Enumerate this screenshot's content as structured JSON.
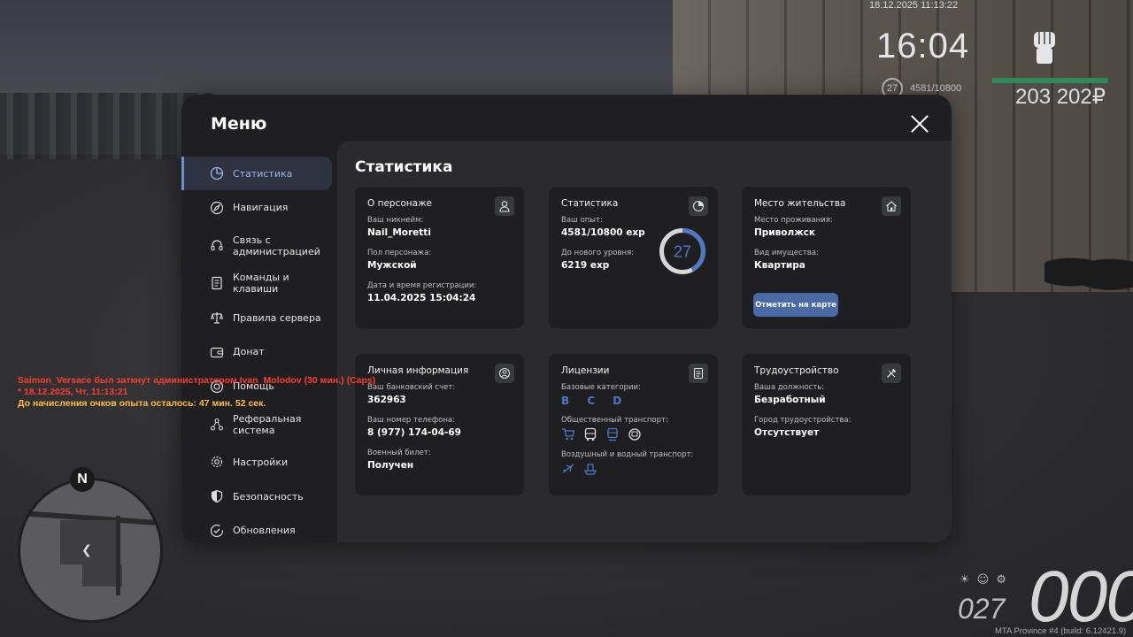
{
  "hud": {
    "datetime": "18.12.2025 11:13:22",
    "clock": "16:04",
    "level": "27",
    "exp": "4581/10800",
    "money": "203 202₽",
    "hp_fraction": 0.99
  },
  "chat": [
    {
      "text": "Saimon_Versace был заткнут администратором Ivan_Molodov (30 мин.) (Caps)",
      "color": "#ff3b2e"
    },
    {
      "text": "* 18.12.2025, Чт, 11:13:21",
      "color": "#ff3b2e"
    },
    {
      "text": "До начисления очков опыта осталось: 47 мин. 52 сек.",
      "color": "#ffbd3a"
    }
  ],
  "minimap": {
    "north_label": "N"
  },
  "speedometer": {
    "gear": "027",
    "speed": "000"
  },
  "build_info": "MTA Province #4 (build: 6.12421.9)",
  "menu": {
    "title": "Меню",
    "sidebar": [
      {
        "label": "Статистика",
        "icon": "pie-chart-icon",
        "active": true
      },
      {
        "label": "Навигация",
        "icon": "compass-icon",
        "active": false
      },
      {
        "label": "Связь с администрацией",
        "icon": "headset-icon",
        "active": false
      },
      {
        "label": "Команды и клавиши",
        "icon": "document-icon",
        "active": false
      },
      {
        "label": "Правила сервера",
        "icon": "scales-icon",
        "active": false
      },
      {
        "label": "Донат",
        "icon": "wallet-icon",
        "active": false
      },
      {
        "label": "Помощь",
        "icon": "help-icon",
        "active": false
      },
      {
        "label": "Реферальная система",
        "icon": "network-icon",
        "active": false
      },
      {
        "label": "Настройки",
        "icon": "gear-icon",
        "active": false
      },
      {
        "label": "Безопасность",
        "icon": "shield-icon",
        "active": false
      },
      {
        "label": "Обновления",
        "icon": "update-icon",
        "active": false
      }
    ],
    "content_title": "Статистика",
    "cards": {
      "character": {
        "title": "О персонаже",
        "nickname_label": "Ваш никнейм:",
        "nickname": "Nail_Moretti",
        "gender_label": "Пол персонажа:",
        "gender": "Мужской",
        "reg_label": "Дата и время регистрации:",
        "reg": "11.04.2025 15:04:24"
      },
      "stats": {
        "title": "Статистика",
        "exp_label": "Ваш опыт:",
        "exp": "4581/10800 exp",
        "next_label": "До нового уровня:",
        "next": "6219 exp",
        "level": "27",
        "progress": 0.424
      },
      "residence": {
        "title": "Место жительства",
        "place_label": "Место проживания:",
        "place": "Приволжск",
        "property_label": "Вид имущества:",
        "property": "Квартира",
        "button": "Отметить на карте"
      },
      "personal": {
        "title": "Личная информация",
        "bank_label": "Ваш банковский счет:",
        "bank": "362963",
        "phone_label": "Ваш номер телефона:",
        "phone": "8 (977) 174-04-69",
        "military_label": "Военный билет:",
        "military": "Получен"
      },
      "licenses": {
        "title": "Лицензии",
        "base_label": "Базовые категории:",
        "base": "B C D",
        "public_label": "Общественный транспорт:",
        "air_label": "Воздушный и водный транспорт:"
      },
      "employment": {
        "title": "Трудоустройство",
        "position_label": "Ваша должность:",
        "position": "Безработный",
        "city_label": "Город трудоустройства:",
        "city": "Отсутствует"
      }
    }
  },
  "colors": {
    "accent": "#4e78c4",
    "button": "#4a6aa6",
    "panel": "#1f1f21",
    "content": "#2b2b2d"
  }
}
